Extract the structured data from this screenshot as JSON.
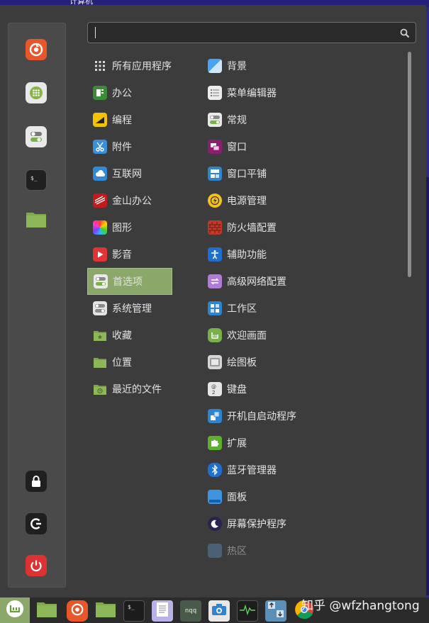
{
  "desktop": {
    "title_fragment": "计算机"
  },
  "search": {
    "value": "",
    "placeholder": ""
  },
  "favorites": [
    {
      "name": "Firefox",
      "icon": "firefox-icon"
    },
    {
      "name": "Software Manager",
      "icon": "software-manager-icon"
    },
    {
      "name": "System Settings",
      "icon": "settings-toggle-icon"
    },
    {
      "name": "Terminal",
      "icon": "terminal-icon"
    },
    {
      "name": "Files",
      "icon": "folder-icon"
    }
  ],
  "session": [
    {
      "name": "Lock Screen",
      "icon": "lock-icon"
    },
    {
      "name": "Log Out",
      "icon": "logout-icon"
    },
    {
      "name": "Quit",
      "icon": "power-icon"
    }
  ],
  "categories": [
    {
      "label": "所有应用程序",
      "icon": "grid-icon"
    },
    {
      "label": "办公",
      "icon": "office-icon"
    },
    {
      "label": "编程",
      "icon": "programming-icon"
    },
    {
      "label": "附件",
      "icon": "scissors-icon"
    },
    {
      "label": "互联网",
      "icon": "cloud-icon"
    },
    {
      "label": "金山办公",
      "icon": "wps-icon"
    },
    {
      "label": "图形",
      "icon": "graphics-icon"
    },
    {
      "label": "影音",
      "icon": "media-icon"
    },
    {
      "label": "首选项",
      "icon": "preferences-icon",
      "selected": true
    },
    {
      "label": "系统管理",
      "icon": "administration-icon"
    },
    {
      "label": "收藏",
      "icon": "favorites-folder-icon"
    },
    {
      "label": "位置",
      "icon": "places-folder-icon"
    },
    {
      "label": "最近的文件",
      "icon": "recent-folder-icon"
    }
  ],
  "apps": [
    {
      "label": "背景",
      "icon": "background-icon"
    },
    {
      "label": "菜单编辑器",
      "icon": "menu-editor-icon"
    },
    {
      "label": "常规",
      "icon": "general-icon"
    },
    {
      "label": "窗口",
      "icon": "windows-icon"
    },
    {
      "label": "窗口平铺",
      "icon": "window-tiling-icon"
    },
    {
      "label": "电源管理",
      "icon": "power-management-icon"
    },
    {
      "label": "防火墙配置",
      "icon": "firewall-icon"
    },
    {
      "label": "辅助功能",
      "icon": "accessibility-icon"
    },
    {
      "label": "高级网络配置",
      "icon": "network-icon"
    },
    {
      "label": "工作区",
      "icon": "workspaces-icon"
    },
    {
      "label": "欢迎画面",
      "icon": "welcome-icon"
    },
    {
      "label": "绘图板",
      "icon": "tablet-icon"
    },
    {
      "label": "键盘",
      "icon": "keyboard-icon"
    },
    {
      "label": "开机自启动程序",
      "icon": "startup-icon"
    },
    {
      "label": "扩展",
      "icon": "extensions-icon"
    },
    {
      "label": "蓝牙管理器",
      "icon": "bluetooth-icon"
    },
    {
      "label": "面板",
      "icon": "panel-icon"
    },
    {
      "label": "屏幕保护程序",
      "icon": "screensaver-icon"
    },
    {
      "label": "热区",
      "icon": "hotcorner-icon",
      "dim": true
    }
  ],
  "taskbar": [
    {
      "name": "Menu",
      "icon": "mint-menu-icon"
    },
    {
      "name": "Show Desktop",
      "icon": "desktop-icon"
    },
    {
      "name": "Firefox",
      "icon": "firefox-icon"
    },
    {
      "name": "Files",
      "icon": "folder-icon"
    },
    {
      "name": "Terminal",
      "icon": "terminal-icon"
    },
    {
      "name": "Text Editor",
      "icon": "text-editor-icon"
    },
    {
      "name": "nqq",
      "icon": "nqq-icon",
      "text": "nqq"
    },
    {
      "name": "Screenshot",
      "icon": "camera-icon"
    },
    {
      "name": "System Monitor",
      "icon": "system-monitor-icon"
    },
    {
      "name": "Update Manager",
      "icon": "update-icon"
    },
    {
      "name": "Chrome",
      "icon": "chrome-icon"
    }
  ],
  "watermark": {
    "text": "知乎 @wfzhangtong"
  },
  "colors": {
    "accent": "#8ba86a",
    "menu_bg": "#3c3c3c",
    "favbar_bg": "#4a4a4a"
  }
}
